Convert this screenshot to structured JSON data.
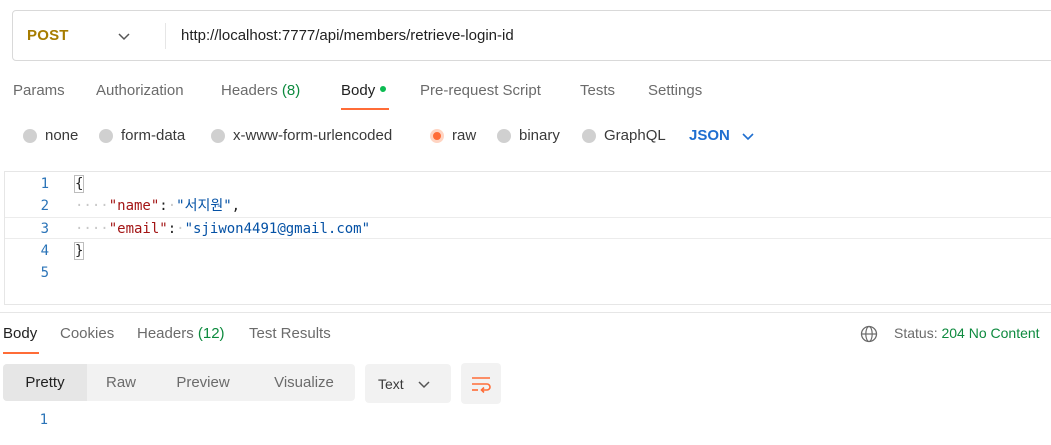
{
  "request": {
    "method": "POST",
    "url": "http://localhost:7777/api/members/retrieve-login-id"
  },
  "request_tabs": [
    {
      "label": "Params",
      "count": ""
    },
    {
      "label": "Authorization",
      "count": ""
    },
    {
      "label": "Headers",
      "count": "(8)"
    },
    {
      "label": "Body",
      "count": ""
    },
    {
      "label": "Pre-request Script",
      "count": ""
    },
    {
      "label": "Tests",
      "count": ""
    },
    {
      "label": "Settings",
      "count": ""
    }
  ],
  "body_types": [
    "none",
    "form-data",
    "x-www-form-urlencoded",
    "raw",
    "binary",
    "GraphQL"
  ],
  "body_selected": "raw",
  "body_format": "JSON",
  "editor": {
    "line_numbers": [
      "1",
      "2",
      "3",
      "4",
      "5"
    ],
    "open_brace": "{",
    "close_brace": "}",
    "indent": "····",
    "fields": [
      {
        "key": "\"name\"",
        "colon": ":",
        "sep": "·",
        "value": "\"서지원\"",
        "trail": ","
      },
      {
        "key": "\"email\"",
        "colon": ":",
        "sep": "·",
        "value": "\"sjiwon4491@gmail.com\"",
        "trail": ""
      }
    ]
  },
  "response_tabs": [
    {
      "label": "Body",
      "count": ""
    },
    {
      "label": "Cookies",
      "count": ""
    },
    {
      "label": "Headers",
      "count": "(12)"
    },
    {
      "label": "Test Results",
      "count": ""
    }
  ],
  "status": {
    "label": "Status:",
    "value": "204 No Content"
  },
  "view_modes": [
    "Pretty",
    "Raw",
    "Preview",
    "Visualize"
  ],
  "view_format": "Text",
  "response_line_numbers": [
    "1"
  ],
  "colors": {
    "accent": "#ff6c37",
    "success": "#0d8a3e",
    "json_blue": "#1f6fd0",
    "method": "#a67c00"
  }
}
